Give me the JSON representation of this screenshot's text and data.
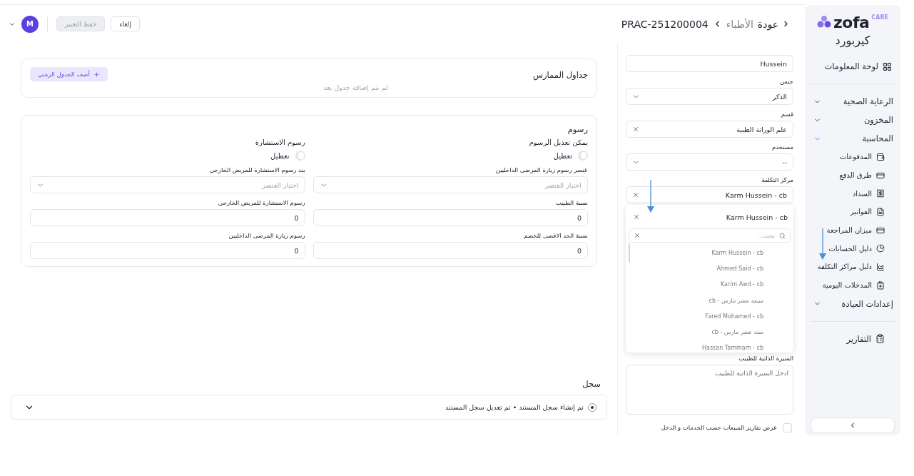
{
  "sidebar": {
    "logo": {
      "name": "zofa",
      "badge": "CARE",
      "subtitle": "كيربورد"
    },
    "top_items": [
      {
        "label": "لوحة المعلومات"
      }
    ],
    "groups": [
      {
        "label": "الرعاية الصحية",
        "expanded": false
      },
      {
        "label": "المخزون",
        "expanded": false
      },
      {
        "label": "المحاسبة",
        "expanded": true,
        "children": [
          {
            "label": "المدفوعات"
          },
          {
            "label": "طرق الدفع"
          },
          {
            "label": "السداد"
          },
          {
            "label": "الفواتير"
          },
          {
            "label": "ميزان المراجعة"
          },
          {
            "label": "دليل الحسابات"
          },
          {
            "label": "دليل مراكز التكلفة"
          },
          {
            "label": "المدخلات اليومية"
          }
        ]
      },
      {
        "label": "إعدادات العيادة",
        "expanded": false
      }
    ],
    "bottom_items": [
      {
        "label": "التقارير"
      }
    ]
  },
  "header": {
    "breadcrumb": [
      {
        "label": "عودة",
        "kind": "back"
      },
      {
        "label": "الأطباء",
        "kind": "link"
      },
      {
        "label": "PRAC-251200004",
        "kind": "current"
      }
    ],
    "buttons": [
      {
        "label": "إلغاء",
        "disabled": false
      },
      {
        "label": "حفظ التغيير",
        "disabled": true
      }
    ],
    "avatar": "M"
  },
  "schedules": {
    "title": "جداول الممارس",
    "empty_text": "لم يتم إضافة جدول بعد",
    "add_button": "أضف الجدول الزمني"
  },
  "fees": {
    "title": "رسوم",
    "columns": [
      {
        "subtitle": "يمكن تعديل الرسوم",
        "toggle": {
          "label": "تعطيل",
          "on": false
        },
        "fields": [
          {
            "kind": "select",
            "label": "عنصر رسوم زيارة المرضى الداخليين",
            "placeholder": "اختيار العنصر"
          },
          {
            "kind": "input",
            "label": "نسبة الطبيب",
            "value": "0"
          },
          {
            "kind": "input",
            "label": "نسبة الحد الاقصى للخصم",
            "value": "0"
          }
        ]
      },
      {
        "subtitle": "رسوم الاستشارة",
        "toggle": {
          "label": "تعطيل",
          "on": false
        },
        "fields": [
          {
            "kind": "select",
            "label": "بند رسوم الاستشارة للمريض الخارجي",
            "placeholder": "اختيار العنصر"
          },
          {
            "kind": "input",
            "label": "رسوم الاستشارة للمريض الخارجي",
            "value": "0"
          },
          {
            "kind": "input",
            "label": "رسوم زيارة المرضى الداخليين",
            "value": "0"
          }
        ]
      }
    ]
  },
  "log": {
    "title": "سجل",
    "entry": "تم إنشاء سجل المستند • تم تعديل سجل المستند"
  },
  "form": {
    "fields": [
      {
        "kind": "input",
        "value": "Hussein"
      },
      {
        "kind": "select",
        "label": "جنس",
        "value": "الذكر",
        "clearable": false
      },
      {
        "kind": "select",
        "label": "قسم",
        "value": "علم الوراثة الطبية",
        "clearable": true
      },
      {
        "kind": "select",
        "label": "مستخدم",
        "value": "--",
        "clearable": false
      },
      {
        "kind": "select",
        "label": "مركز التكلفة",
        "value": "Karm Hussein - cb",
        "clearable": true
      }
    ],
    "dropdown": {
      "open": true,
      "selected": "Karm Hussein - cb",
      "search_placeholder": "بحث...",
      "options": [
        "Karm Hussein - cb",
        "Ahmed Said - cb",
        "Karim Awd - cb",
        "سبعة عشر مارس - cb",
        "Fared Mohamed - cb",
        "ستة عشر مارس - cb",
        "Hassan Tammam - cb"
      ]
    },
    "bio": {
      "label": "السيرة الذاتية للطبيب",
      "placeholder": "ادخل السيرة الذاتية للطبيب"
    },
    "checkbox": {
      "label": "عرض تقارير المبيعات حسب الخدمات و الدخل",
      "checked": false
    }
  }
}
